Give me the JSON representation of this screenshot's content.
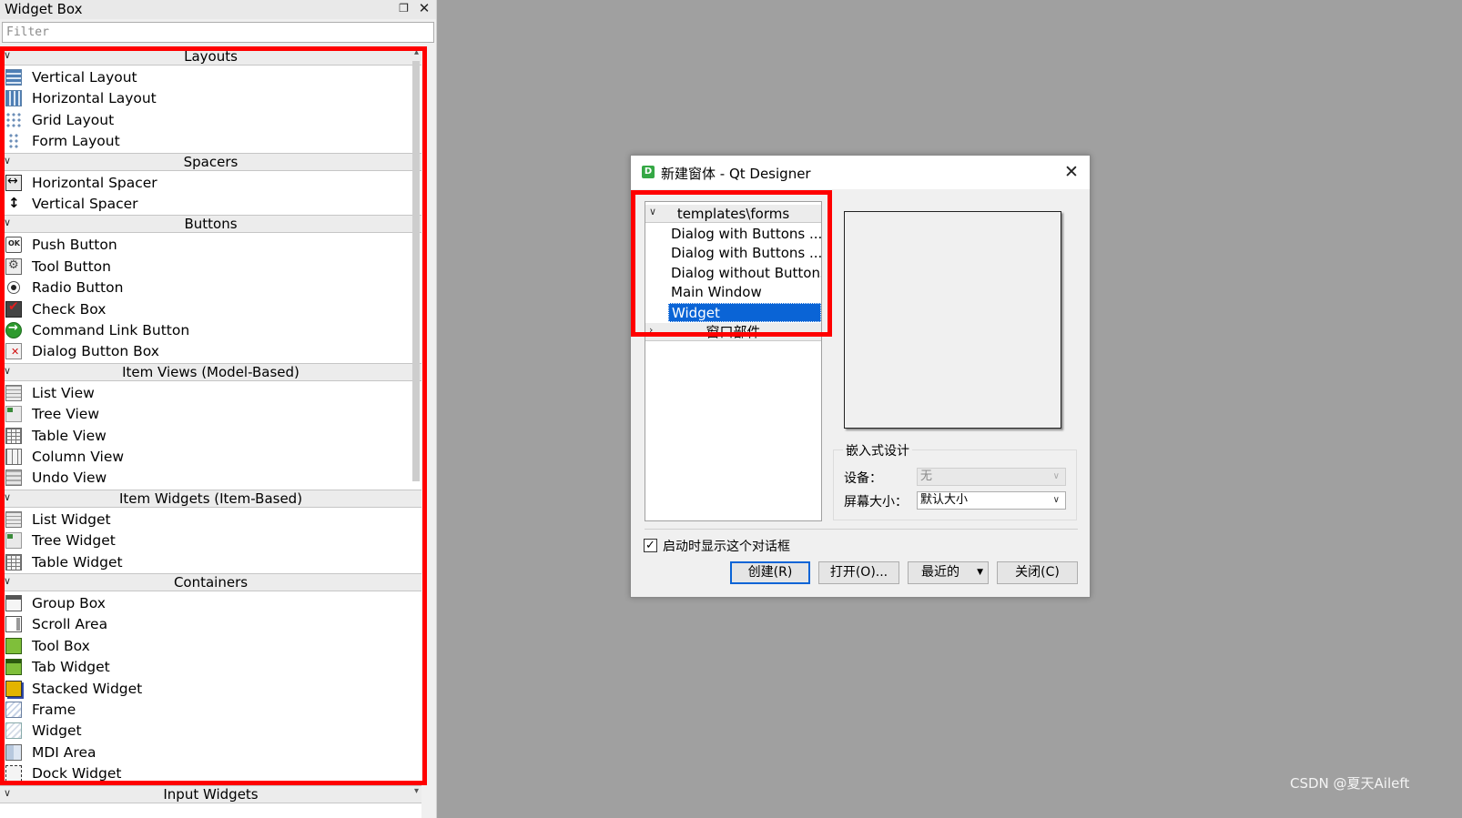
{
  "widget_box": {
    "title": "Widget Box",
    "float_icon": "float-icon",
    "close_icon": "close-icon",
    "filter_placeholder": "Filter",
    "categories": [
      {
        "label": "Layouts",
        "items": [
          {
            "label": "Vertical Layout",
            "icon": "vertical-layout-icon"
          },
          {
            "label": "Horizontal Layout",
            "icon": "horizontal-layout-icon"
          },
          {
            "label": "Grid Layout",
            "icon": "grid-layout-icon"
          },
          {
            "label": "Form Layout",
            "icon": "form-layout-icon"
          }
        ]
      },
      {
        "label": "Spacers",
        "items": [
          {
            "label": "Horizontal Spacer",
            "icon": "horizontal-spacer-icon"
          },
          {
            "label": "Vertical Spacer",
            "icon": "vertical-spacer-icon"
          }
        ]
      },
      {
        "label": "Buttons",
        "items": [
          {
            "label": "Push Button",
            "icon": "push-button-icon"
          },
          {
            "label": "Tool Button",
            "icon": "tool-button-icon"
          },
          {
            "label": "Radio Button",
            "icon": "radio-button-icon"
          },
          {
            "label": "Check Box",
            "icon": "check-box-icon"
          },
          {
            "label": "Command Link Button",
            "icon": "command-link-icon"
          },
          {
            "label": "Dialog Button Box",
            "icon": "dialog-button-box-icon"
          }
        ]
      },
      {
        "label": "Item Views (Model-Based)",
        "items": [
          {
            "label": "List View",
            "icon": "list-view-icon"
          },
          {
            "label": "Tree View",
            "icon": "tree-view-icon"
          },
          {
            "label": "Table View",
            "icon": "table-view-icon"
          },
          {
            "label": "Column View",
            "icon": "column-view-icon"
          },
          {
            "label": "Undo View",
            "icon": "undo-view-icon"
          }
        ]
      },
      {
        "label": "Item Widgets (Item-Based)",
        "items": [
          {
            "label": "List Widget",
            "icon": "list-widget-icon"
          },
          {
            "label": "Tree Widget",
            "icon": "tree-widget-icon"
          },
          {
            "label": "Table Widget",
            "icon": "table-widget-icon"
          }
        ]
      },
      {
        "label": "Containers",
        "items": [
          {
            "label": "Group Box",
            "icon": "group-box-icon"
          },
          {
            "label": "Scroll Area",
            "icon": "scroll-area-icon"
          },
          {
            "label": "Tool Box",
            "icon": "tool-box-icon"
          },
          {
            "label": "Tab Widget",
            "icon": "tab-widget-icon"
          },
          {
            "label": "Stacked Widget",
            "icon": "stacked-widget-icon"
          },
          {
            "label": "Frame",
            "icon": "frame-icon"
          },
          {
            "label": "Widget",
            "icon": "widget-icon"
          },
          {
            "label": "MDI Area",
            "icon": "mdi-area-icon"
          },
          {
            "label": "Dock Widget",
            "icon": "dock-widget-icon"
          }
        ]
      },
      {
        "label": "Input Widgets",
        "items": []
      }
    ]
  },
  "dialog": {
    "title": "新建窗体 - Qt Designer",
    "app_icon_letter": "D",
    "templates": {
      "group1": "templates\\forms",
      "items": [
        {
          "label": "Dialog with Buttons ..."
        },
        {
          "label": "Dialog with Buttons ..."
        },
        {
          "label": "Dialog without Buttons"
        },
        {
          "label": "Main Window"
        },
        {
          "label": "Widget"
        }
      ],
      "selected": "Widget",
      "group2": "窗口部件"
    },
    "embedded": {
      "title": "嵌入式设计",
      "device_label": "设备：",
      "device_value": "无",
      "screen_label": "屏幕大小：",
      "screen_value": "默认大小"
    },
    "show_on_startup": {
      "label": "启动时显示这个对话框",
      "checked": true
    },
    "buttons": {
      "create": "创建(R)",
      "open": "打开(O)...",
      "recent": "最近的",
      "close": "关闭(C)"
    }
  },
  "watermark": "CSDN @夏天Aileft",
  "colors": {
    "highlight": "#ff0000",
    "selection": "#0a64d6",
    "desktop": "#a0a0a0"
  }
}
